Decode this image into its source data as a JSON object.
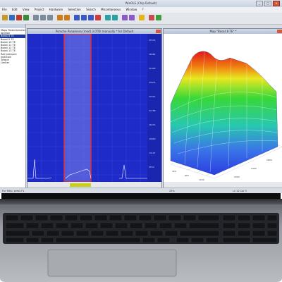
{
  "app_title": "WinOLS (Chip Default)",
  "menu": [
    "File",
    "Edit",
    "View",
    "Project",
    "Hardware",
    "Selection",
    "Search",
    "Miscellaneous",
    "Window",
    "?"
  ],
  "hex_window_title": "Porsche Panamera (mod) 3.0TDI manually * for Default",
  "map_window_title": "Map \"Boost 8 TE\" *",
  "left_panel_lines": [
    "Maps Potentiometer",
    "Ignition",
    "Boost 8 TE",
    "Boost 9 TE",
    "Boost 10 TE",
    "Boost 11 TE",
    "Boost 12 TE",
    "Boost 13 TE",
    "Rail pressure",
    "Injection",
    "Torque",
    "Limiter"
  ],
  "status": {
    "left": "For Help, press F1",
    "zoom": "25%",
    "right": "Ln 12  Col 3"
  },
  "colors": {
    "plot_bg": "#1e2bc8",
    "map_peak": "#e01818"
  }
}
